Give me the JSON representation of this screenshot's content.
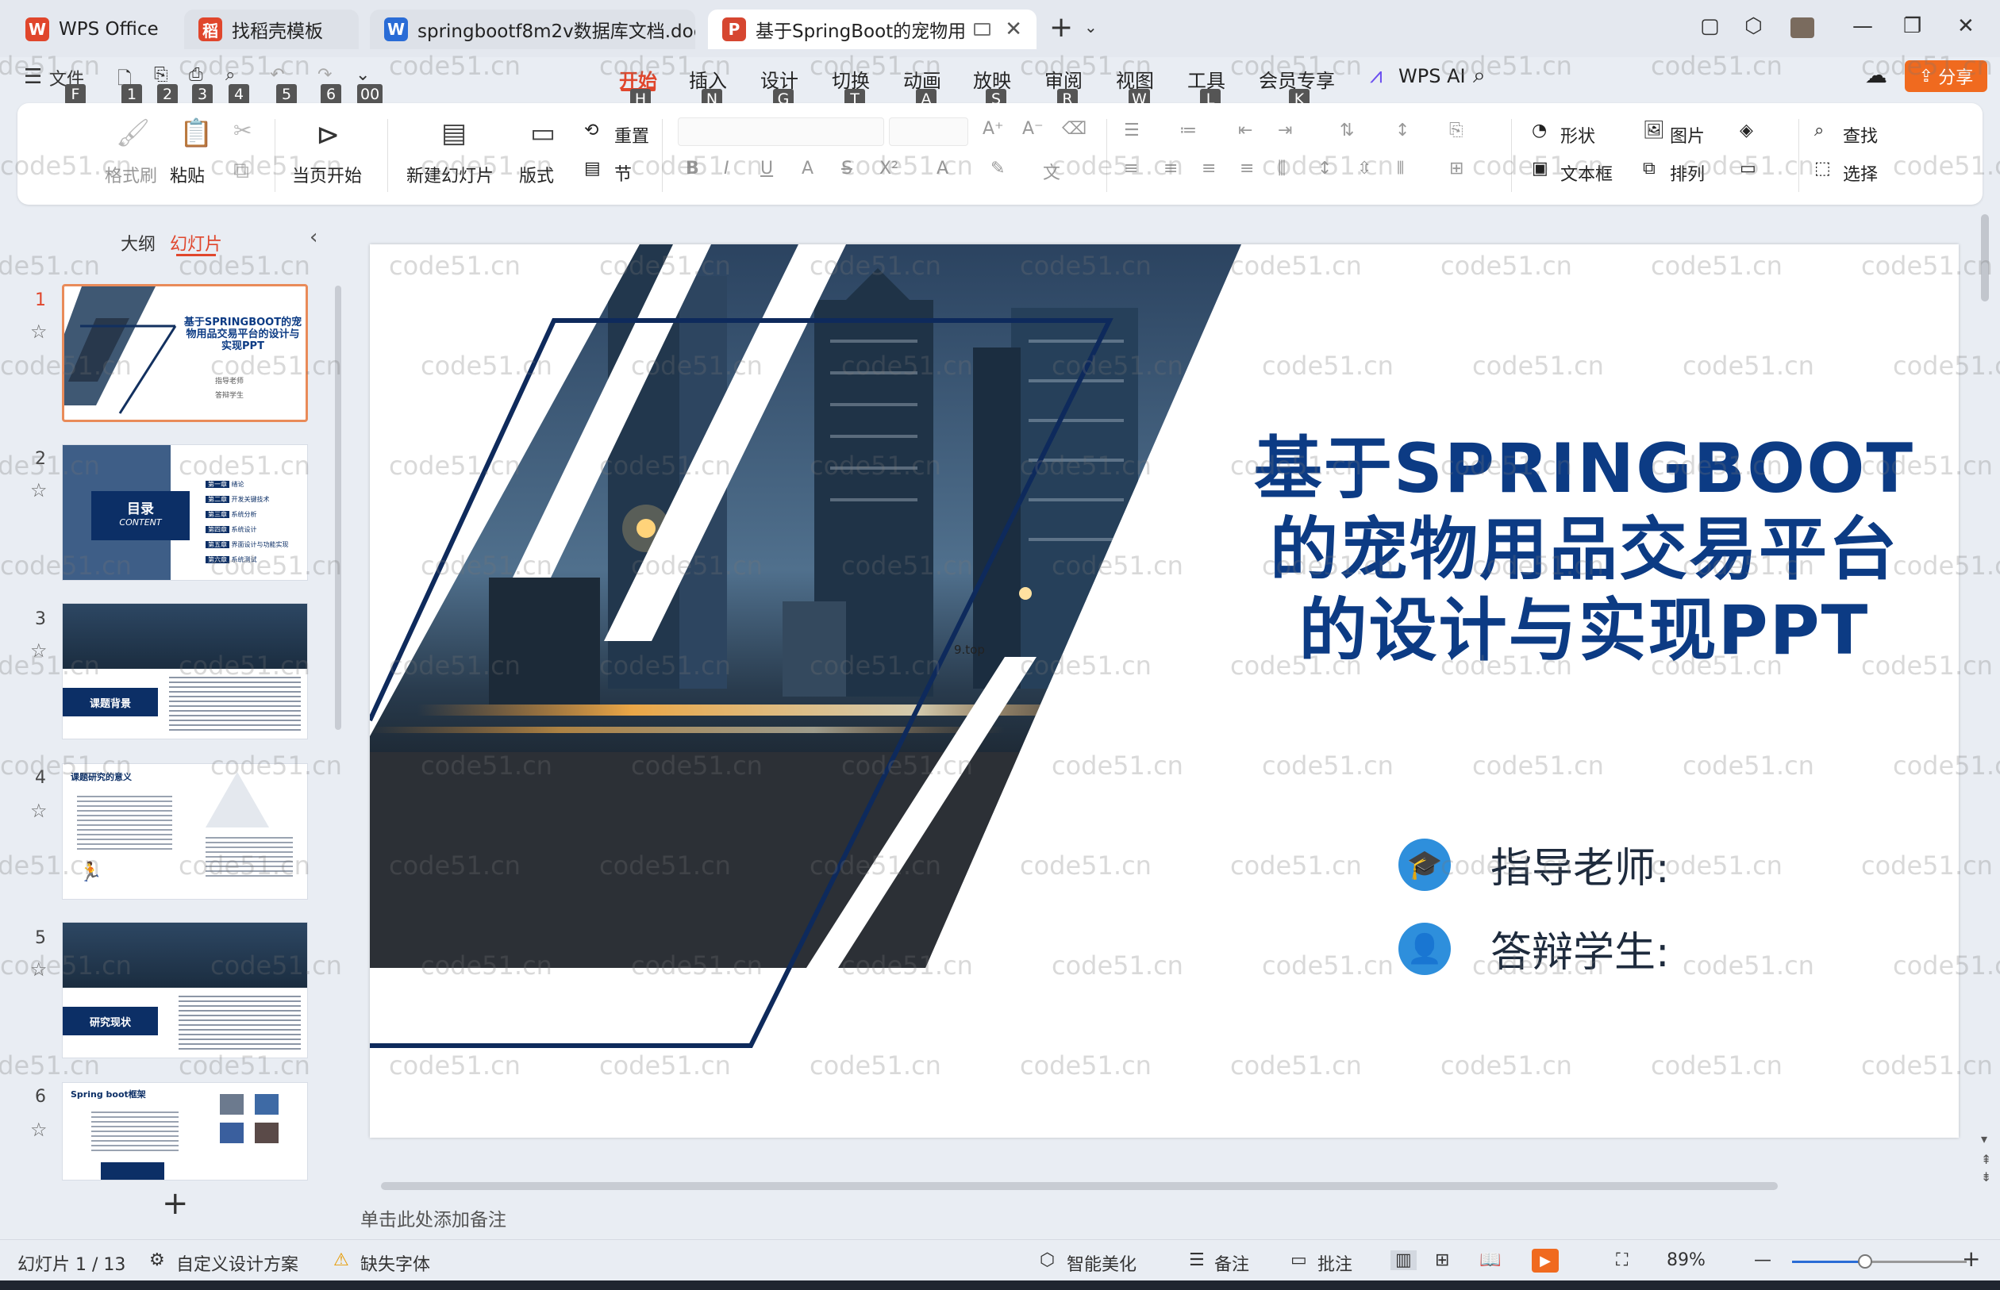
{
  "tabs": [
    {
      "label": "WPS Office",
      "icon": "W",
      "color": "#e0462c"
    },
    {
      "label": "找稻壳模板",
      "icon": "稻",
      "color": "#e0462c"
    },
    {
      "label": "springbootf8m2v数据库文档.doc",
      "icon": "W",
      "color": "#2a6cd6"
    },
    {
      "label": "基于SpringBoot的宠物用品交",
      "icon": "P",
      "color": "#d64630"
    }
  ],
  "quick_access": {
    "file": "文件",
    "keytips": [
      "F",
      "1",
      "2",
      "3",
      "4",
      "5",
      "6",
      "00"
    ]
  },
  "menu": [
    {
      "label": "开始",
      "key": "H"
    },
    {
      "label": "插入",
      "key": "N"
    },
    {
      "label": "设计",
      "key": "G"
    },
    {
      "label": "切换",
      "key": "T"
    },
    {
      "label": "动画",
      "key": "A"
    },
    {
      "label": "放映",
      "key": "S"
    },
    {
      "label": "审阅",
      "key": "R"
    },
    {
      "label": "视图",
      "key": "W"
    },
    {
      "label": "工具",
      "key": "L"
    },
    {
      "label": "会员专享",
      "key": "K"
    }
  ],
  "wps_ai": "WPS AI",
  "share": "分享",
  "ribbon": {
    "format_painter": "格式刷",
    "paste": "粘贴",
    "start_from_current": "当页开始",
    "new_slide": "新建幻灯片",
    "layout": "版式",
    "reset": "重置",
    "section": "节",
    "shape": "形状",
    "picture": "图片",
    "textbox": "文本框",
    "arrange": "排列",
    "find": "查找",
    "select": "选择"
  },
  "left_panel": {
    "outline_tab": "大纲",
    "slides_tab": "幻灯片",
    "slides": [
      {
        "num": "1",
        "title": "基于SPRINGBOOT的宠物用品交易平台的设计与实现PPT",
        "sub1": "指导老师",
        "sub2": "答辩学生"
      },
      {
        "num": "2",
        "title": "目录",
        "sub": "CONTENT",
        "items": [
          "绪论",
          "开发关键技术",
          "系统分析",
          "系统设计",
          "界面设计与功能实现",
          "系统测试"
        ],
        "item_tags": [
          "第一章",
          "第二章",
          "第三章",
          "第四章",
          "第五章",
          "第六章"
        ]
      },
      {
        "num": "3",
        "title": "课题背景"
      },
      {
        "num": "4",
        "title": "课题研究的意义"
      },
      {
        "num": "5",
        "title": "研究现状"
      },
      {
        "num": "6",
        "title": "Spring boot框架"
      }
    ]
  },
  "slide": {
    "title_lines": [
      "基于SPRINGBOOT",
      "的宠物用品交易平台",
      "的设计与实现PPT"
    ],
    "advisor": "指导老师:",
    "student": "答辩学生:",
    "small_text": "9.top"
  },
  "notes_placeholder": "单击此处添加备注",
  "status": {
    "slide_counter": "幻灯片 1 / 13",
    "custom_design": "自定义设计方案",
    "missing_fonts": "缺失字体",
    "smart_beautify": "智能美化",
    "notes": "备注",
    "comments": "批注",
    "zoom": "89%",
    "zoom_fraction": 0.42
  },
  "watermark": "code51.cn",
  "colors": {
    "accent": "#e0462c",
    "title_blue": "#0c3b84",
    "share": "#f06a1f"
  }
}
